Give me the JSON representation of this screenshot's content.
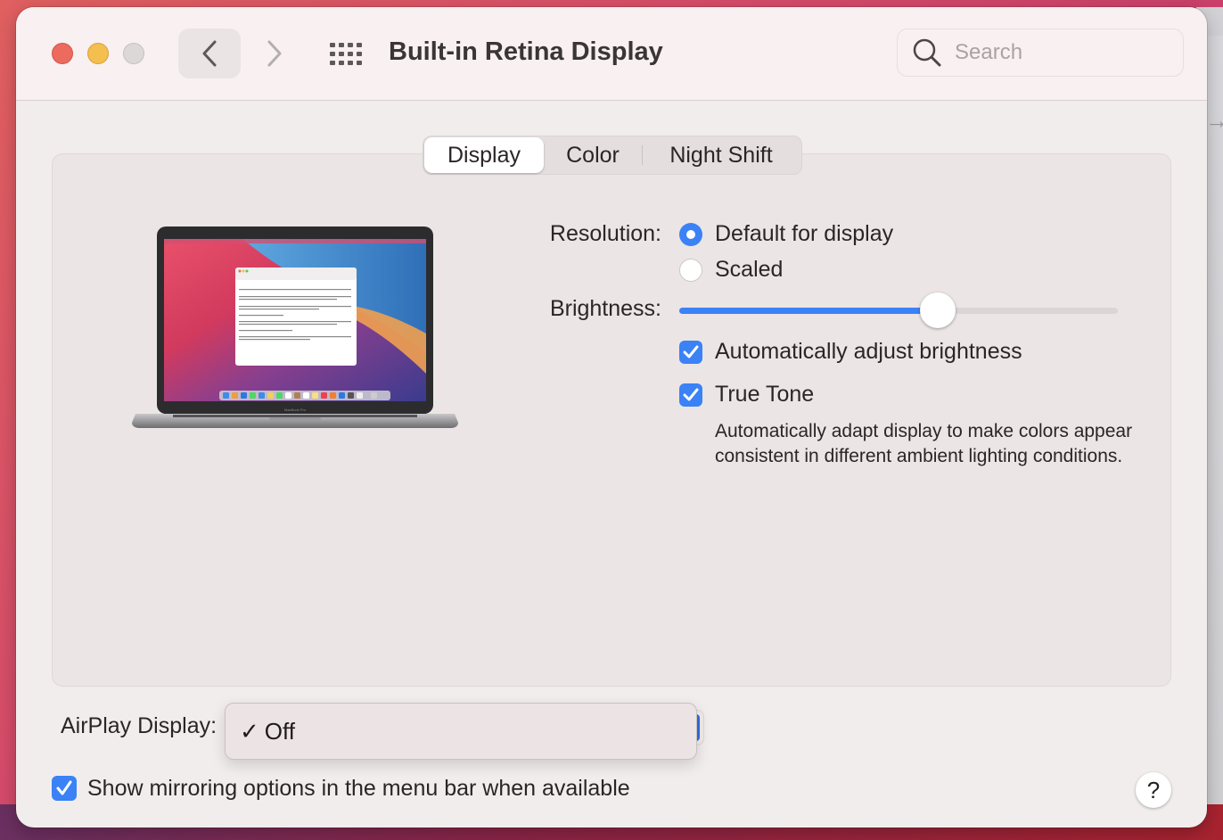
{
  "window": {
    "title": "Built-in Retina Display",
    "search_placeholder": "Search",
    "search_value": ""
  },
  "tabs": [
    {
      "label": "Display",
      "active": true
    },
    {
      "label": "Color",
      "active": false
    },
    {
      "label": "Night Shift",
      "active": false
    }
  ],
  "display": {
    "resolution_label": "Resolution:",
    "resolution_options": [
      {
        "label": "Default for display",
        "selected": true
      },
      {
        "label": "Scaled",
        "selected": false
      }
    ],
    "brightness_label": "Brightness:",
    "brightness_percent": 59,
    "auto_brightness_label": "Automatically adjust brightness",
    "auto_brightness_checked": true,
    "true_tone_label": "True Tone",
    "true_tone_checked": true,
    "true_tone_description": "Automatically adapt display to make colors appear consistent in different ambient lighting conditions.",
    "laptop_caption": "MacBook Pro"
  },
  "airplay": {
    "label": "AirPlay Display:",
    "menu_check": "✓",
    "selected_value": "Off"
  },
  "mirroring": {
    "label": "Show mirroring options in the menu bar when available",
    "checked": true
  },
  "help_label": "?",
  "colors": {
    "accent": "#3a82f6",
    "close": "#ed6a5e",
    "minimize": "#f5bf4f",
    "zoom_disabled": "#dcd8d8"
  }
}
